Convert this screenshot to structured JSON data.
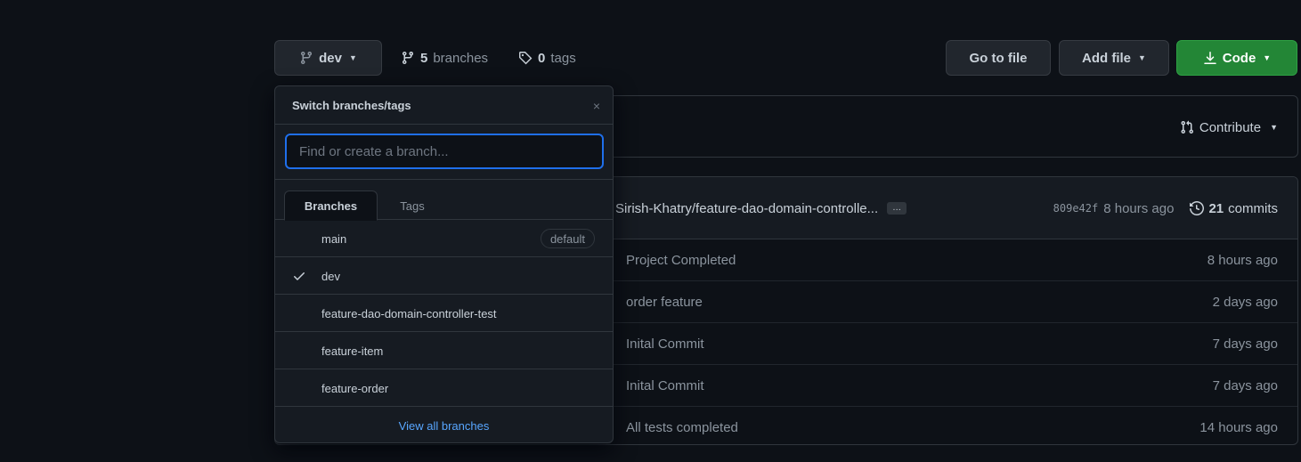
{
  "toolbar": {
    "current_branch": "dev",
    "branches_count": "5",
    "branches_label": "branches",
    "tags_count": "0",
    "tags_label": "tags",
    "go_to_file": "Go to file",
    "add_file": "Add file",
    "code": "Code"
  },
  "contribute": {
    "label": "Contribute"
  },
  "latest_commit": {
    "message": "Sirish-Khatry/feature-dao-domain-controlle...",
    "ellipsis": "…",
    "sha": "809e42f",
    "time": "8 hours ago",
    "commits_count": "21",
    "commits_label": "commits"
  },
  "files": [
    {
      "message": "Project Completed",
      "time": "8 hours ago"
    },
    {
      "message": "order feature",
      "time": "2 days ago"
    },
    {
      "message": "Inital Commit",
      "time": "7 days ago"
    },
    {
      "message": "Inital Commit",
      "time": "7 days ago"
    },
    {
      "message": "All tests completed",
      "time": "14 hours ago"
    }
  ],
  "dropdown": {
    "title": "Switch branches/tags",
    "close": "×",
    "search_placeholder": "Find or create a branch...",
    "tabs": {
      "branches": "Branches",
      "tags": "Tags"
    },
    "branches": [
      {
        "name": "main",
        "badge": "default",
        "selected": false
      },
      {
        "name": "dev",
        "selected": true
      },
      {
        "name": "feature-dao-domain-controller-test",
        "selected": false
      },
      {
        "name": "feature-item",
        "selected": false
      },
      {
        "name": "feature-order",
        "selected": false
      }
    ],
    "view_all": "View all branches"
  },
  "colors": {
    "background": "#0d1117",
    "primary_green": "#238636",
    "focus_blue": "#1f6feb",
    "link_blue": "#58a6ff"
  }
}
